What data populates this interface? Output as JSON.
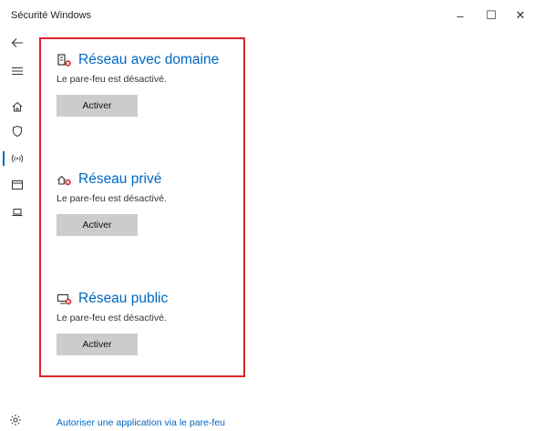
{
  "window": {
    "title": "Sécurité Windows",
    "minimize_glyph": "–",
    "maximize_glyph": "☐",
    "close_glyph": "✕"
  },
  "sidebar": {
    "items": [
      {
        "icon": "back-arrow-icon"
      },
      {
        "icon": "hamburger-menu-icon"
      },
      {
        "icon": "home-icon"
      },
      {
        "icon": "shield-icon"
      },
      {
        "icon": "wireless-antenna-icon",
        "active": true
      },
      {
        "icon": "browser-window-icon"
      },
      {
        "icon": "laptop-icon"
      }
    ],
    "settings_icon": "gear-icon"
  },
  "networks": [
    {
      "title": "Réseau avec domaine",
      "status": "Le pare-feu est désactivé.",
      "button": "Activer",
      "icon": "domain-network-icon"
    },
    {
      "title": "Réseau privé",
      "status": "Le pare-feu est désactivé.",
      "button": "Activer",
      "icon": "private-network-icon"
    },
    {
      "title": "Réseau public",
      "status": "Le pare-feu est désactivé.",
      "button": "Activer",
      "icon": "public-network-icon"
    }
  ],
  "links": {
    "allow_app": "Autoriser une application via le pare-feu"
  },
  "colors": {
    "accent": "#0067c0",
    "highlight_border": "#e0242a",
    "warning_badge": "#d13438",
    "button_bg": "#cccccc"
  }
}
